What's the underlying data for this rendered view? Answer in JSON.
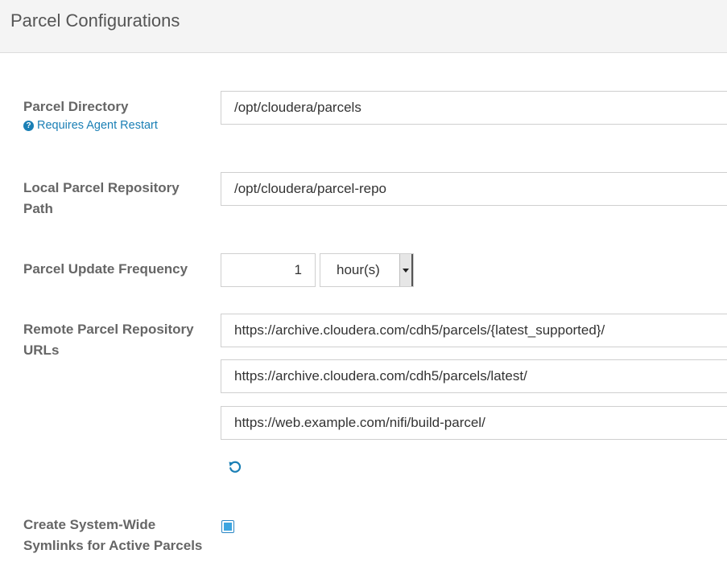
{
  "header": {
    "title": "Parcel Configurations"
  },
  "parcel_directory": {
    "label": "Parcel Directory",
    "note": "Requires Agent Restart",
    "value": "/opt/cloudera/parcels"
  },
  "local_repo": {
    "label": "Local Parcel Repository Path",
    "value": "/opt/cloudera/parcel-repo"
  },
  "update_frequency": {
    "label": "Parcel Update Frequency",
    "value": "1",
    "unit": "hour(s)"
  },
  "remote_repos": {
    "label": "Remote Parcel Repository URLs",
    "urls": [
      "https://archive.cloudera.com/cdh5/parcels/{latest_supported}/",
      "https://archive.cloudera.com/cdh5/parcels/latest/",
      "https://web.example.com/nifi/build-parcel/"
    ]
  },
  "symlinks": {
    "label": "Create System-Wide Symlinks for Active Parcels",
    "checked": true
  },
  "icons": {
    "note_icon": "question-circle-icon",
    "reset_icon": "undo-icon",
    "dropdown_icon": "caret-down-icon"
  },
  "colors": {
    "link": "#1a7fb5",
    "checkbox_fill": "#3da5e0",
    "header_bg": "#f4f4f4"
  }
}
